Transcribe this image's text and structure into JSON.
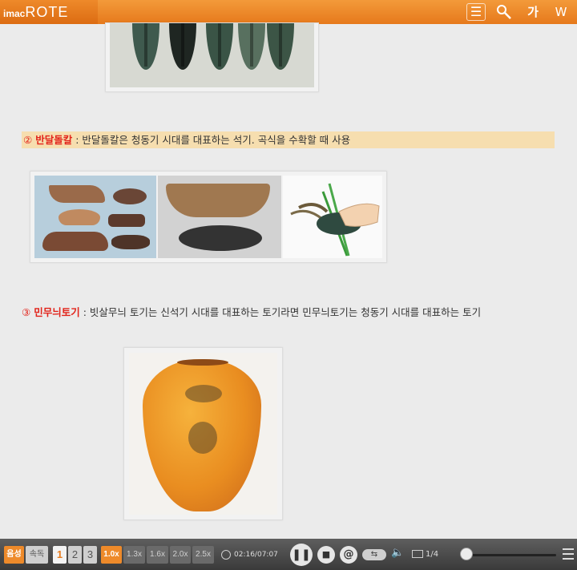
{
  "app": {
    "logo_small": "imac",
    "logo_big": "ROTE"
  },
  "toolbar": {
    "menu_icon": "menu-icon",
    "search_icon": "search-icon",
    "font_glyph": "가",
    "bookmark_glyph": "W"
  },
  "sections": [
    {
      "number": "②",
      "term": "반달돌칼",
      "description": " : 반달돌칼은 청동기 시대를 대표하는 석기. 곡식을 수확할 때 사용"
    },
    {
      "number": "③",
      "term": "민무늬토기",
      "description": " : 빗살무늬 토기는 신석기 시대를 대표하는 토기라면 민무늬토기는 청동기 시대를 대표하는 토기"
    }
  ],
  "player": {
    "voice_label": "음성",
    "speed_label": "속독",
    "numbers": [
      "1",
      "2",
      "3"
    ],
    "rates": [
      "1.0x",
      "1.3x",
      "1.6x",
      "2.0x",
      "2.5x"
    ],
    "time": "02:16/07:07",
    "pages": "1/4",
    "repeat_glyph": "⇆",
    "progress": 0.0
  },
  "colors": {
    "accent": "#ee8a2a",
    "highlight_text": "#e2231a",
    "caption_bg": "#f6deaf"
  }
}
